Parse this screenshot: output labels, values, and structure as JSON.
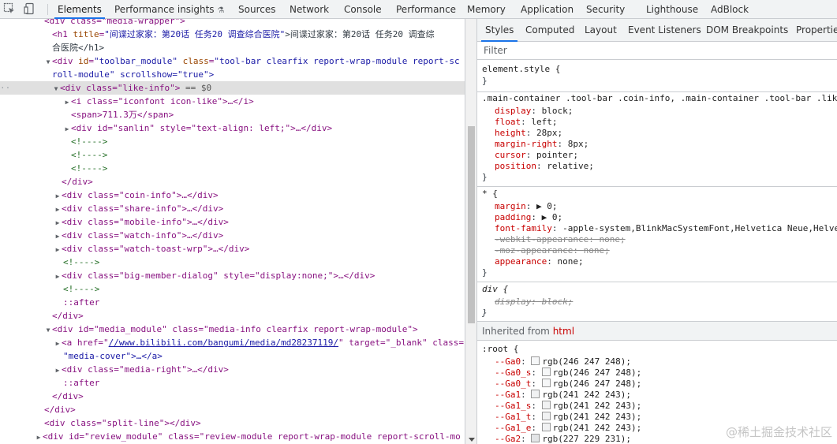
{
  "devtools": {
    "tabs": [
      "Elements",
      "Performance insights",
      "Sources",
      "Network",
      "Console",
      "Performance",
      "Memory",
      "Application",
      "Security",
      "Lighthouse",
      "AdBlock"
    ],
    "active_tab": "Elements"
  },
  "elements": {
    "selected_suffix": "== $0",
    "lines": [
      {
        "t": "partial",
        "text": "<div class=\"media-wrapper\">"
      },
      {
        "t": "h1",
        "open": "<h1 ",
        "attr": "title",
        "val": "\"间谍过家家：第20话 任务20 调查综合医院\"",
        "text": ">间谍过家家：第20话 任务20 调查综"
      },
      {
        "t": "text2",
        "text": "合医院</h1>"
      },
      {
        "t": "div3",
        "a1": "id",
        "v1": "\"toolbar_module\"",
        "a2": "class",
        "v2": "\"tool-bar clearfix report-wrap-module report-sc"
      },
      {
        "t": "text2",
        "text": "roll-module\" scrollshow=\"true\">"
      },
      {
        "t": "sel",
        "text": "<div class=\"like-info\">"
      },
      {
        "t": "el",
        "text": "<i class=\"iconfont icon-like\">…</i>"
      },
      {
        "t": "span",
        "text": "<span>711.3万</span>"
      },
      {
        "t": "el2",
        "text": "<div id=\"sanlin\" style=\"text-align: left;\">…</div>"
      },
      {
        "t": "cm",
        "text": "<!---->"
      },
      {
        "t": "cm",
        "text": "<!---->"
      },
      {
        "t": "cm",
        "text": "<!---->"
      },
      {
        "t": "close",
        "text": "</div>"
      },
      {
        "t": "el",
        "text": "<div class=\"coin-info\">…</div>"
      },
      {
        "t": "el",
        "text": "<div class=\"share-info\">…</div>"
      },
      {
        "t": "el",
        "text": "<div class=\"mobile-info\">…</div>"
      },
      {
        "t": "el",
        "text": "<div class=\"watch-info\">…</div>"
      },
      {
        "t": "el",
        "text": "<div class=\"watch-toast-wrp\">…</div>"
      },
      {
        "t": "cm",
        "text": "<!---->"
      },
      {
        "t": "el",
        "text": "<div class=\"big-member-dialog\" style=\"display:none;\">…</div>"
      },
      {
        "t": "cm",
        "text": "<!---->"
      },
      {
        "t": "pseudo",
        "text": "::after"
      },
      {
        "t": "close",
        "text": "</div>"
      },
      {
        "t": "div3",
        "text": "<div id=\"media_module\" class=\"media-info clearfix report-wrap-module\">"
      },
      {
        "t": "link",
        "pre": "<a href=\"",
        "link": "//www.bilibili.com/bangumi/media/md28237119/",
        "post": "\" target=\"_blank\" class="
      },
      {
        "t": "text2",
        "text": "\"media-cover\">…</a>"
      },
      {
        "t": "el",
        "text": "<div class=\"media-right\">…</div>"
      },
      {
        "t": "pseudo",
        "text": "::after"
      },
      {
        "t": "close",
        "text": "</div>"
      },
      {
        "t": "close",
        "text": "</div>"
      },
      {
        "t": "close",
        "text": "<div class=\"split-line\"></div>"
      },
      {
        "t": "partial",
        "text": "<div id=\"review_module\" class=\"review-module report-wrap-module report-scroll-mo"
      }
    ]
  },
  "styles": {
    "tabs": [
      "Styles",
      "Computed",
      "Layout",
      "Event Listeners",
      "DOM Breakpoints",
      "Properties"
    ],
    "active_tab": "Styles",
    "filter_placeholder": "Filter",
    "element_style": "element.style {",
    "close_brace": "}",
    "rule1_selector": ".main-container .tool-bar .coin-info, .main-container .tool-bar .like-info",
    "rule1_props": [
      {
        "p": "display",
        "v": "block;"
      },
      {
        "p": "float",
        "v": "left;"
      },
      {
        "p": "height",
        "v": "28px;"
      },
      {
        "p": "margin-right",
        "v": "8px;"
      },
      {
        "p": "cursor",
        "v": "pointer;"
      },
      {
        "p": "position",
        "v": "relative;"
      }
    ],
    "rule2_selector": "* {",
    "rule2_props": [
      {
        "p": "margin",
        "v": "▶ 0;",
        "s": false
      },
      {
        "p": "padding",
        "v": "▶ 0;",
        "s": false
      },
      {
        "p": "font-family",
        "v": "-apple-system,BlinkMacSystemFont,Helvetica Neue,Helvetica",
        "s": false
      },
      {
        "p": "-webkit-appearance",
        "v": "none;",
        "s": true
      },
      {
        "p": "-moz-appearance",
        "v": "none;",
        "s": true
      },
      {
        "p": "appearance",
        "v": "none;",
        "s": false
      }
    ],
    "rule3_selector": "div {",
    "rule3_prop": {
      "p": "display",
      "v": "block;"
    },
    "inherited_label": "Inherited from",
    "inherited_tag": "html",
    "root_selector": ":root {",
    "root_vars": [
      {
        "p": "--Ga0",
        "v": "rgb(246 247 248);",
        "c": "#f6f7f8"
      },
      {
        "p": "--Ga0_s",
        "v": "rgb(246 247 248);",
        "c": "#f6f7f8"
      },
      {
        "p": "--Ga0_t",
        "v": "rgb(246 247 248);",
        "c": "#f6f7f8"
      },
      {
        "p": "--Ga1",
        "v": "rgb(241 242 243);",
        "c": "#f1f2f3"
      },
      {
        "p": "--Ga1_s",
        "v": "rgb(241 242 243);",
        "c": "#f1f2f3"
      },
      {
        "p": "--Ga1_t",
        "v": "rgb(241 242 243);",
        "c": "#f1f2f3"
      },
      {
        "p": "--Ga1_e",
        "v": "rgb(241 242 243);",
        "c": "#f1f2f3"
      },
      {
        "p": "--Ga2",
        "v": "rgb(227 229 231);",
        "c": "#e3e5e7"
      }
    ],
    "watermark": "@稀土掘金技术社区"
  }
}
